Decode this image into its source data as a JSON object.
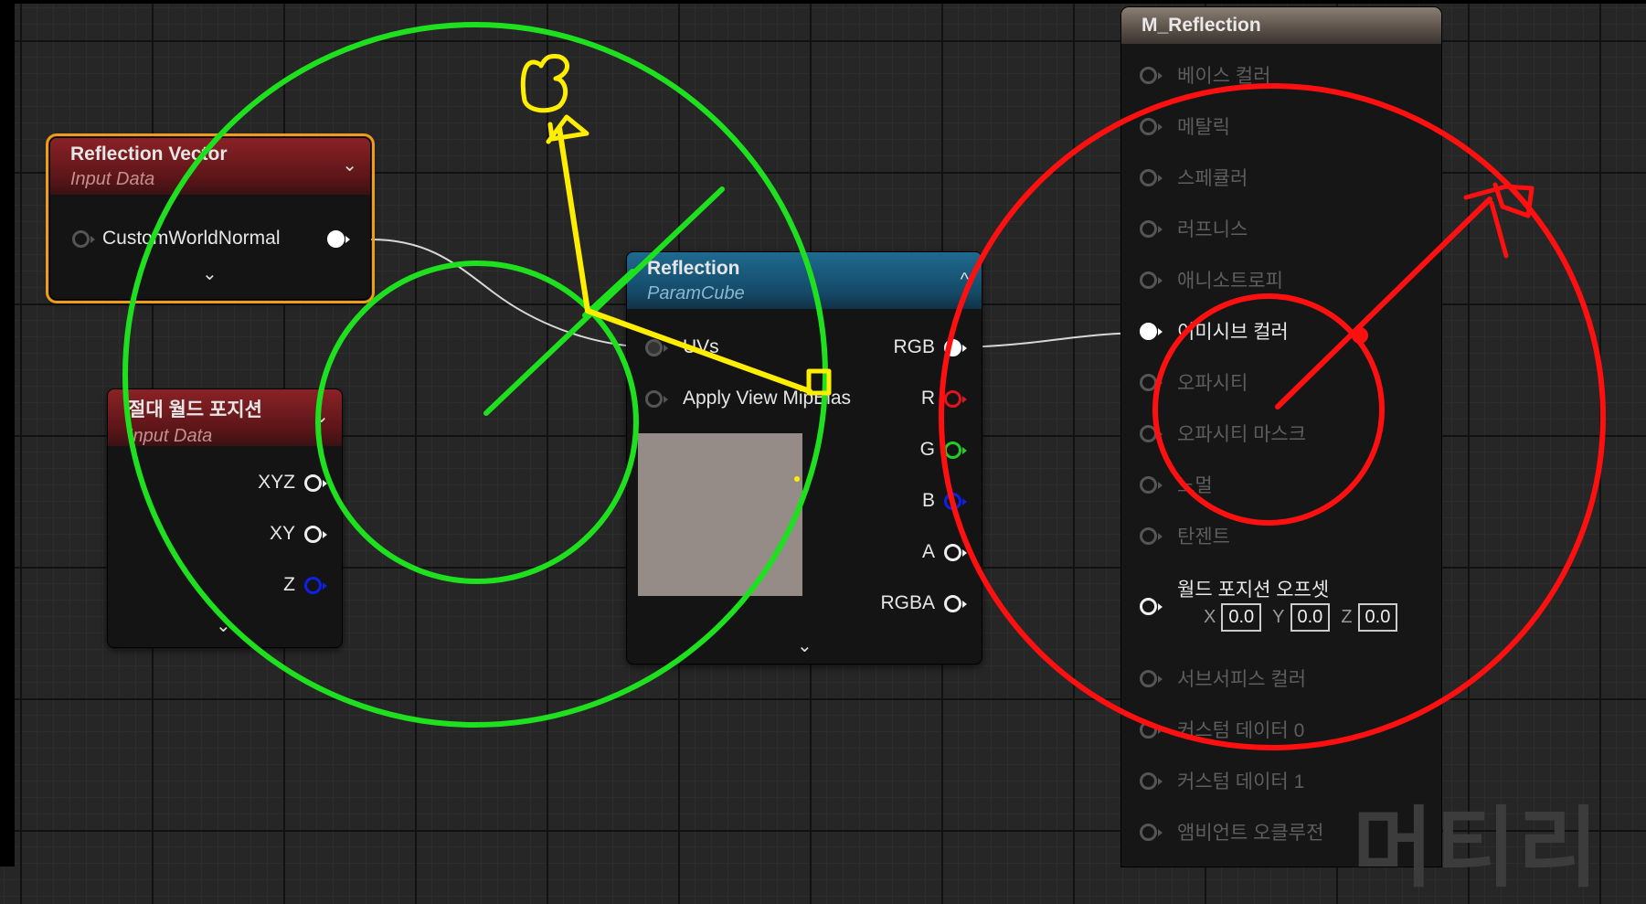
{
  "nodes": {
    "reflection_vector": {
      "title": "Reflection Vector",
      "subtitle": "Input Data",
      "pin_output": "CustomWorldNormal",
      "expand_glyph": "⌄",
      "collapse_glyph": "⌄"
    },
    "absolute_world_position": {
      "title": "절대 월드 포지션",
      "subtitle": "Input Data",
      "pins": [
        "XYZ",
        "XY",
        "Z"
      ],
      "expand_glyph": "⌄",
      "collapse_glyph": "⌄"
    },
    "reflection": {
      "title": "Reflection",
      "subtitle": "ParamCube",
      "inputs": [
        "UVs",
        "Apply View MipBias"
      ],
      "outputs": [
        "RGB",
        "R",
        "G",
        "B",
        "A",
        "RGBA"
      ],
      "expand_glyph": "⌄",
      "collapse_glyph": "^"
    }
  },
  "material": {
    "title": "M_Reflection",
    "inputs": [
      "베이스 컬러",
      "메탈릭",
      "스페큘러",
      "러프니스",
      "애니소트로피",
      "이미시브 컬러",
      "오파시티",
      "오파시티 마스크",
      "노멀",
      "탄젠트",
      "월드 포지션 오프셋",
      "서브서피스 컬러",
      "커스텀 데이터 0",
      "커스텀 데이터 1",
      "앰비언트 오클루전"
    ],
    "wpo": {
      "x_label": "X",
      "x": "0.0",
      "y_label": "Y",
      "y": "0.0",
      "z_label": "Z",
      "z": "0.0"
    }
  },
  "watermark": "머티리",
  "colors": {
    "annotation_green": "#1ee01e",
    "annotation_yellow": "#ffee00",
    "annotation_red": "#ff1010",
    "selection_orange": "#f09b1a",
    "input_header_red": "#8a2226",
    "texture_header_blue": "#1e6a90"
  }
}
